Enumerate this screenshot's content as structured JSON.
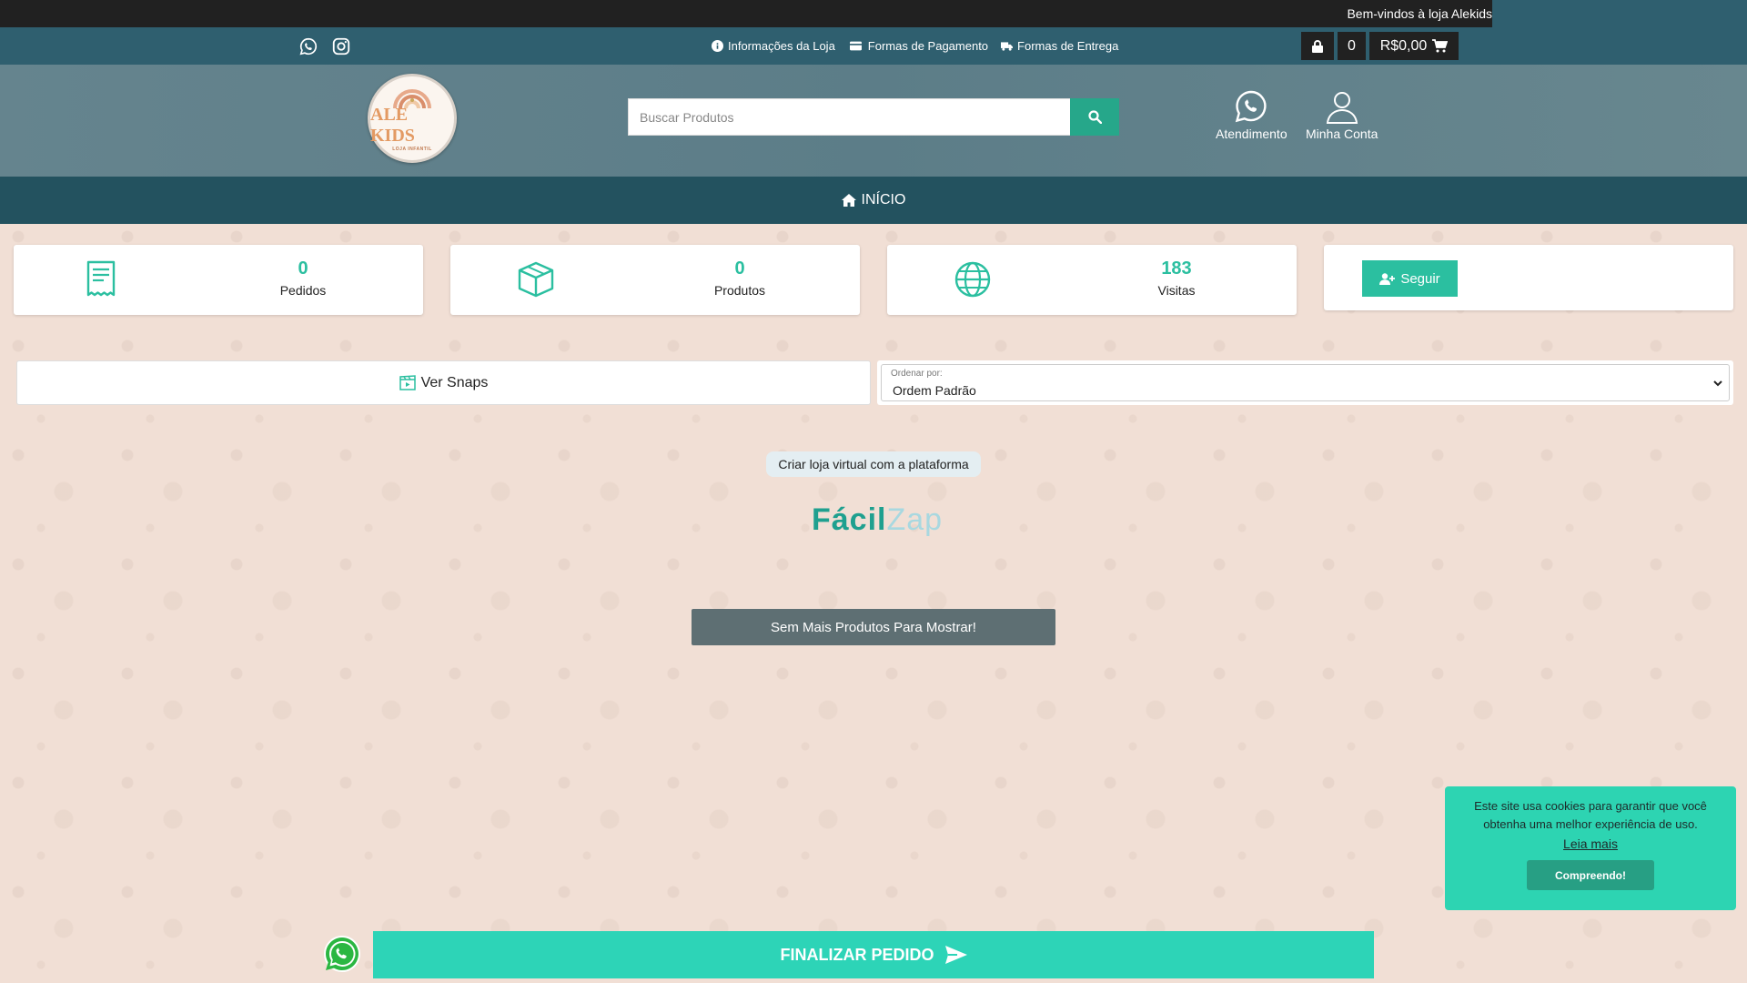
{
  "marquee": {
    "text": "Bem-vindos à loja Alekids"
  },
  "info_bar": {
    "links": [
      {
        "label": "Informações da Loja"
      },
      {
        "label": "Formas de Pagamento"
      },
      {
        "label": "Formas de Entrega"
      }
    ],
    "cart": {
      "count": "0",
      "total": "R$0,00"
    }
  },
  "header": {
    "logo_text": "ALE KIDS",
    "logo_sub": "LOJA INFANTIL",
    "search_placeholder": "Buscar Produtos",
    "support_label": "Atendimento",
    "account_label": "Minha Conta"
  },
  "nav": {
    "home_label": "INÍCIO"
  },
  "stats": {
    "orders": {
      "value": "0",
      "label": "Pedidos"
    },
    "products": {
      "value": "0",
      "label": "Produtos"
    },
    "visits": {
      "value": "183",
      "label": "Visitas"
    },
    "follow_label": "Seguir"
  },
  "toolbar": {
    "snaps_label": "Ver Snaps",
    "sort_label": "Ordenar por:",
    "sort_value": "Ordem Padrão"
  },
  "platform": {
    "text": "Criar loja virtual com a plataforma",
    "logo_part1": "Fácil",
    "logo_part2": "Zap"
  },
  "no_more_label": "Sem Mais Produtos Para Mostrar!",
  "cookie": {
    "text": "Este site usa cookies para garantir que você obtenha uma melhor experiência de uso.",
    "more_label": "Leia mais",
    "accept_label": "Compreendo!"
  },
  "finalize_label": "FINALIZAR PEDIDO",
  "colors": {
    "accent": "#2bbfa0",
    "info_bar": "#2f5f6f",
    "nav": "#23525f",
    "background": "#f1dfd5"
  }
}
